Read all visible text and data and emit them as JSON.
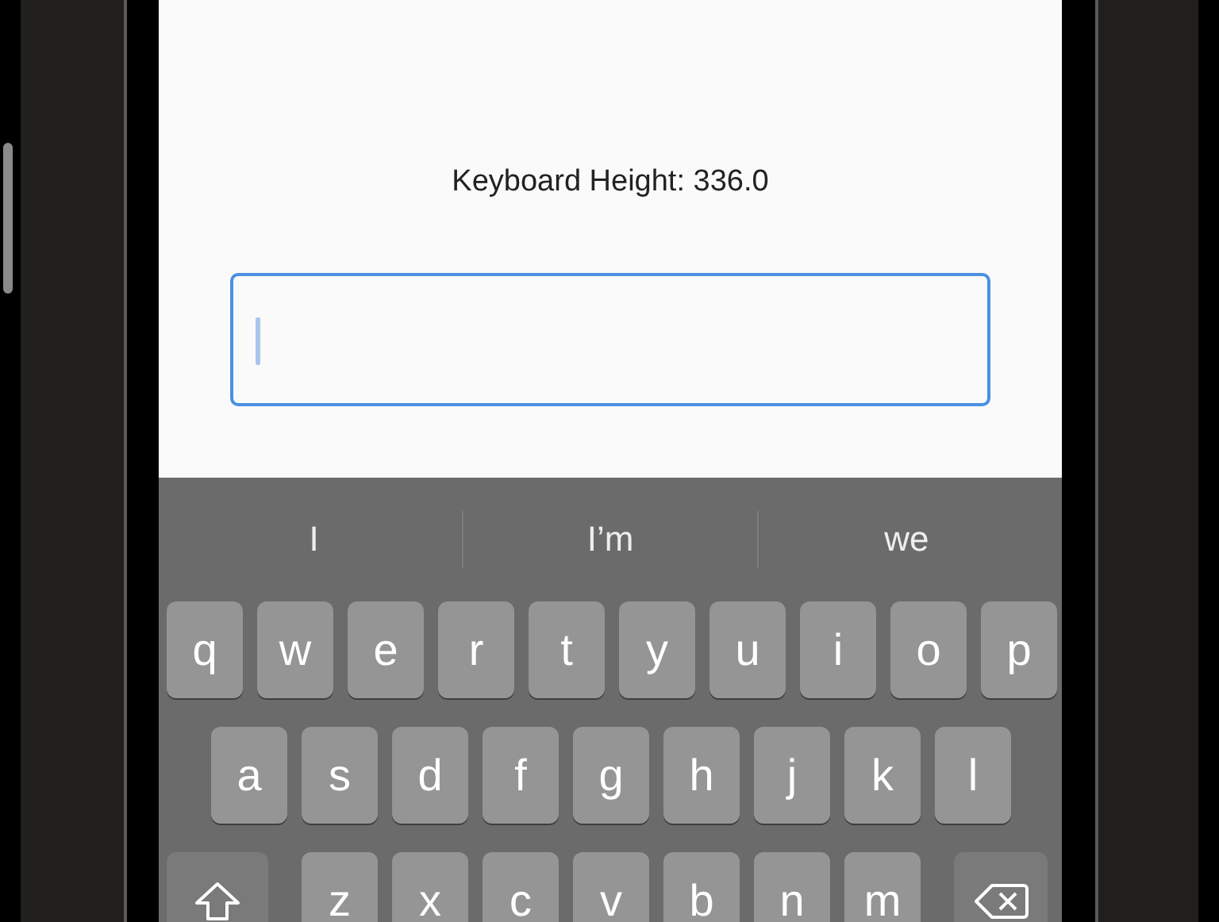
{
  "screen": {
    "label": "Keyboard Height: 336.0",
    "text_field": {
      "focused": true
    }
  },
  "keyboard": {
    "suggestions": [
      "I",
      "I’m",
      "we"
    ],
    "rows": [
      [
        {
          "kind": "letter",
          "label": "q"
        },
        {
          "kind": "letter",
          "label": "w"
        },
        {
          "kind": "letter",
          "label": "e"
        },
        {
          "kind": "letter",
          "label": "r"
        },
        {
          "kind": "letter",
          "label": "t"
        },
        {
          "kind": "letter",
          "label": "y"
        },
        {
          "kind": "letter",
          "label": "u"
        },
        {
          "kind": "letter",
          "label": "i"
        },
        {
          "kind": "letter",
          "label": "o"
        },
        {
          "kind": "letter",
          "label": "p"
        }
      ],
      [
        {
          "kind": "letter",
          "label": "a"
        },
        {
          "kind": "letter",
          "label": "s"
        },
        {
          "kind": "letter",
          "label": "d"
        },
        {
          "kind": "letter",
          "label": "f"
        },
        {
          "kind": "letter",
          "label": "g"
        },
        {
          "kind": "letter",
          "label": "h"
        },
        {
          "kind": "letter",
          "label": "j"
        },
        {
          "kind": "letter",
          "label": "k"
        },
        {
          "kind": "letter",
          "label": "l"
        }
      ],
      [
        {
          "kind": "shift"
        },
        {
          "kind": "letter",
          "label": "z"
        },
        {
          "kind": "letter",
          "label": "x"
        },
        {
          "kind": "letter",
          "label": "c"
        },
        {
          "kind": "letter",
          "label": "v"
        },
        {
          "kind": "letter",
          "label": "b"
        },
        {
          "kind": "letter",
          "label": "n"
        },
        {
          "kind": "letter",
          "label": "m"
        },
        {
          "kind": "delete"
        }
      ]
    ]
  }
}
